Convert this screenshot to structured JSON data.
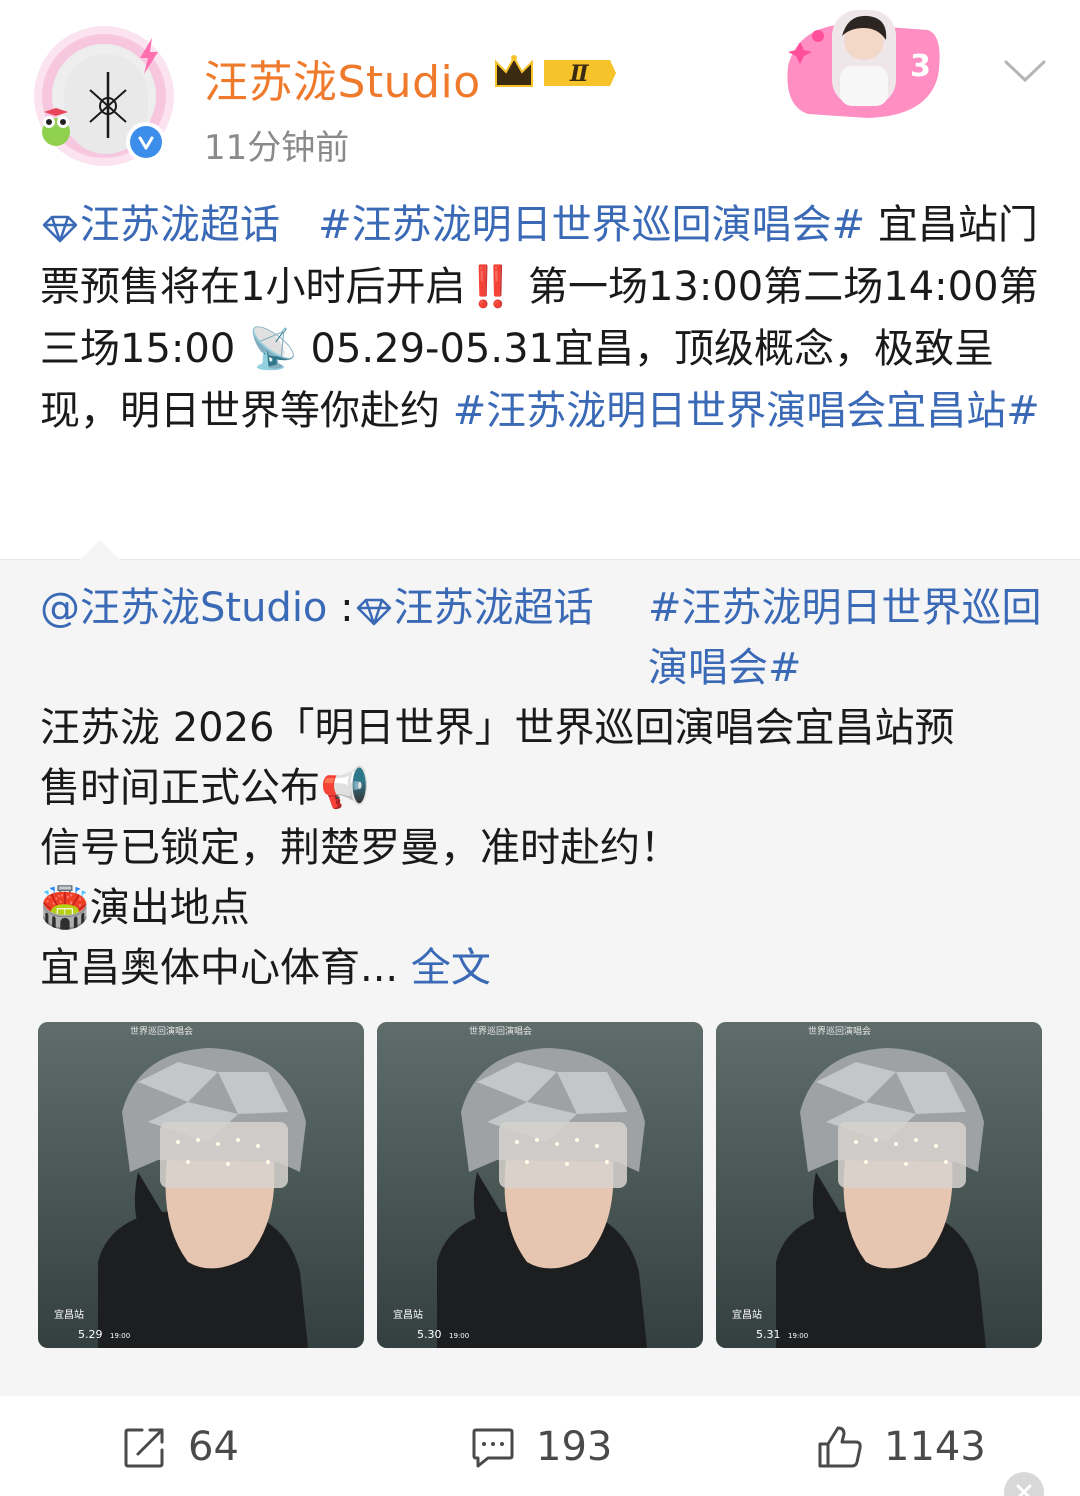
{
  "author": {
    "name": "汪苏泷Studio",
    "time": "11分钟前",
    "crown_level": "Ⅱ"
  },
  "post": {
    "topic_chaohua": "汪苏泷超话",
    "hashtag_1": "#汪苏泷明日世界巡回演唱会#",
    "text_1": " 宜昌站门票预售将在1小时后开启",
    "emoji_alert": "‼️",
    "text_2": " 第一场13:00第二场14:00第三场15:00 ",
    "emoji_satellite": "📡",
    "text_3": " 05.29-05.31宜昌，顶级概念，极致呈现，明日世界等你赴约 ",
    "hashtag_2": "#汪苏泷明日世界演唱会宜昌站#"
  },
  "repost": {
    "mention": "@汪苏泷Studio",
    "sep": " :",
    "topic_chaohua": "汪苏泷超话",
    "hashtag": "#汪苏泷明日世界巡回演唱会#",
    "line_1": "汪苏泷 2026「明日世界」世界巡回演唱会宜昌站预",
    "line_2": "售时间正式公布",
    "emoji_megaphone": "📢",
    "line_3": "信号已锁定，荆楚罗曼，准时赴约！",
    "emoji_stadium": "🏟️",
    "line_4": "演出地点",
    "line_5": "宜昌奥体中心体育...",
    "full_text_link": "全文",
    "images": [
      {
        "title": "世界巡回演唱会",
        "station": "宜昌站",
        "date": "5.29",
        "time": "19:00"
      },
      {
        "title": "世界巡回演唱会",
        "station": "宜昌站",
        "date": "5.30",
        "time": "19:00"
      },
      {
        "title": "世界巡回演唱会",
        "station": "宜昌站",
        "date": "5.31",
        "time": "19:00"
      }
    ]
  },
  "actions": {
    "repost_count": "64",
    "comment_count": "193",
    "like_count": "1143"
  },
  "colors": {
    "username": "#f07a2c",
    "link": "#3a69b6",
    "repost_bg": "#f5f5f6",
    "verified": "#3d8eea"
  }
}
